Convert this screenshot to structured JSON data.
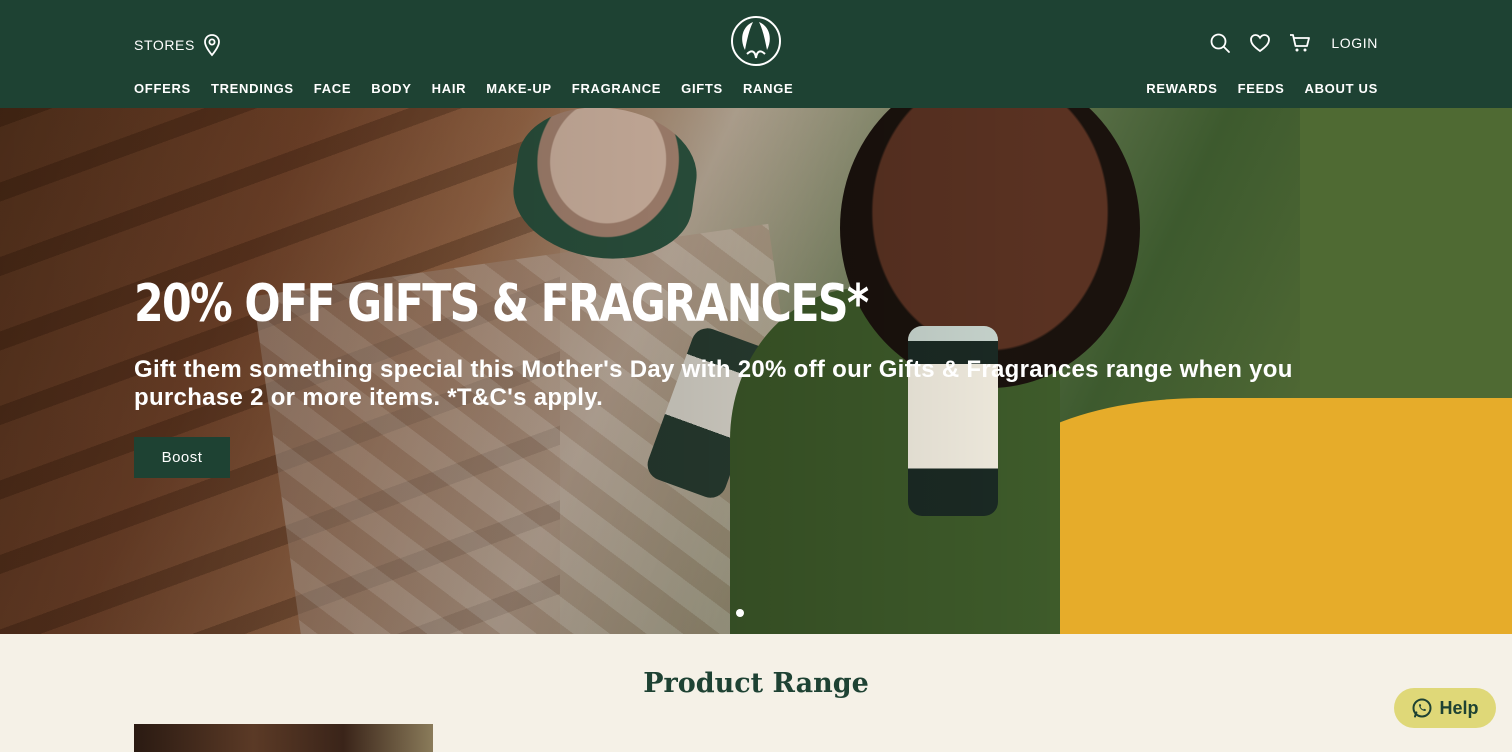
{
  "header": {
    "stores_label": "STORES",
    "login_label": "LOGIN",
    "nav_left": [
      "OFFERS",
      "TRENDINGS",
      "FACE",
      "BODY",
      "HAIR",
      "MAKE-UP",
      "FRAGRANCE",
      "GIFTS",
      "RANGE"
    ],
    "nav_right": [
      "REWARDS",
      "FEEDS",
      "ABOUT US"
    ]
  },
  "hero": {
    "title": "20% OFF GIFTS & FRAGRANCES*",
    "subtitle": "Gift them something special this Mother's Day with 20% off our Gifts & Fragrances range when you purchase 2 or more items. *T&C's apply.",
    "button_label": "Boost"
  },
  "product_range": {
    "title": "Product Range"
  },
  "help": {
    "label": "Help"
  },
  "icons": {
    "stores": "map-pin-icon",
    "logo": "body-shop-logo",
    "search": "search-icon",
    "wishlist": "heart-icon",
    "cart": "cart-icon",
    "help": "whatsapp-icon"
  },
  "colors": {
    "header_bg": "#1e4233",
    "page_bg": "#f5f1e7",
    "help_bg": "#dfd878"
  }
}
